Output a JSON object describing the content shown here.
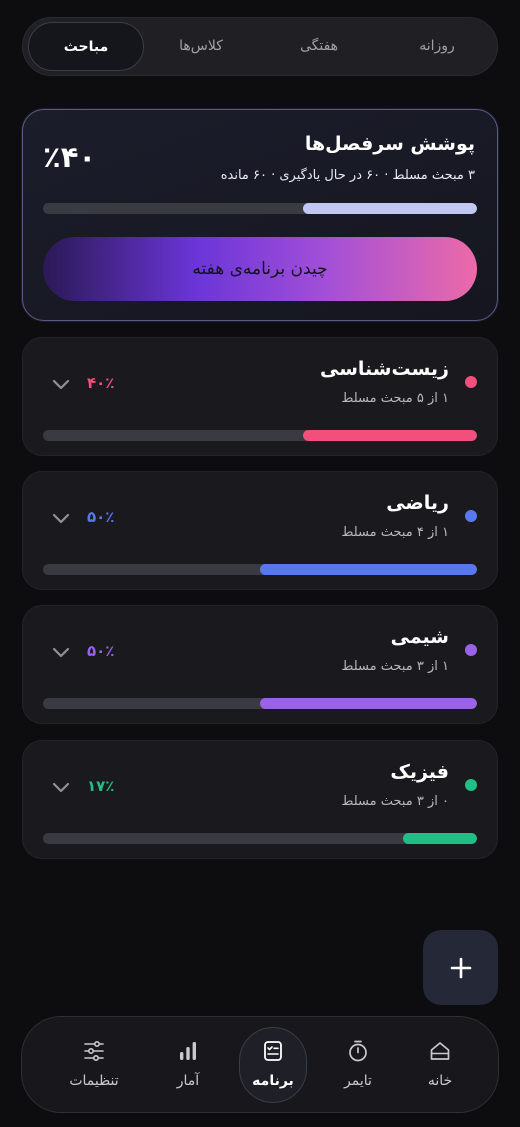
{
  "tabs": [
    "روزانه",
    "هفتگی",
    "کلاس‌ها",
    "مباحث"
  ],
  "coverage": {
    "title": "پوشش سرفصل‌ها",
    "subtitle": "۳ مبحث مسلط · ۶۰ در حال یادگیری · ۶۰ مانده",
    "percent_label": "٪۴۰",
    "progress": 0.4,
    "plan_button": "چیدن برنامه‌ی هفته"
  },
  "subjects": [
    {
      "name": "زیست‌شناسی",
      "detail": "۱ از ۵ مبحث مسلط",
      "percent_label": "۴۰٪",
      "progress": 0.4,
      "color": "#f24f7d"
    },
    {
      "name": "ریاضی",
      "detail": "۱ از ۴ مبحث مسلط",
      "percent_label": "۵۰٪",
      "progress": 0.5,
      "color": "#5978f0"
    },
    {
      "name": "شیمی",
      "detail": "۱ از ۳ مبحث مسلط",
      "percent_label": "۵۰٪",
      "progress": 0.5,
      "color": "#9a62e6"
    },
    {
      "name": "فیزیک",
      "detail": "۰ از ۳ مبحث مسلط",
      "percent_label": "۱۷٪",
      "progress": 0.17,
      "color": "#1fbf86"
    }
  ],
  "fab": {
    "icon": "plus-icon"
  },
  "nav": [
    {
      "label": "تنظیمات",
      "icon": "sliders-icon"
    },
    {
      "label": "آمار",
      "icon": "bar-chart-icon"
    },
    {
      "label": "برنامه",
      "icon": "checklist-icon"
    },
    {
      "label": "تایمر",
      "icon": "stopwatch-icon"
    },
    {
      "label": "خانه",
      "icon": "home-icon"
    }
  ],
  "colors": {
    "coverage_fill": "#c0c8f2",
    "accent": "#7c4dff"
  }
}
